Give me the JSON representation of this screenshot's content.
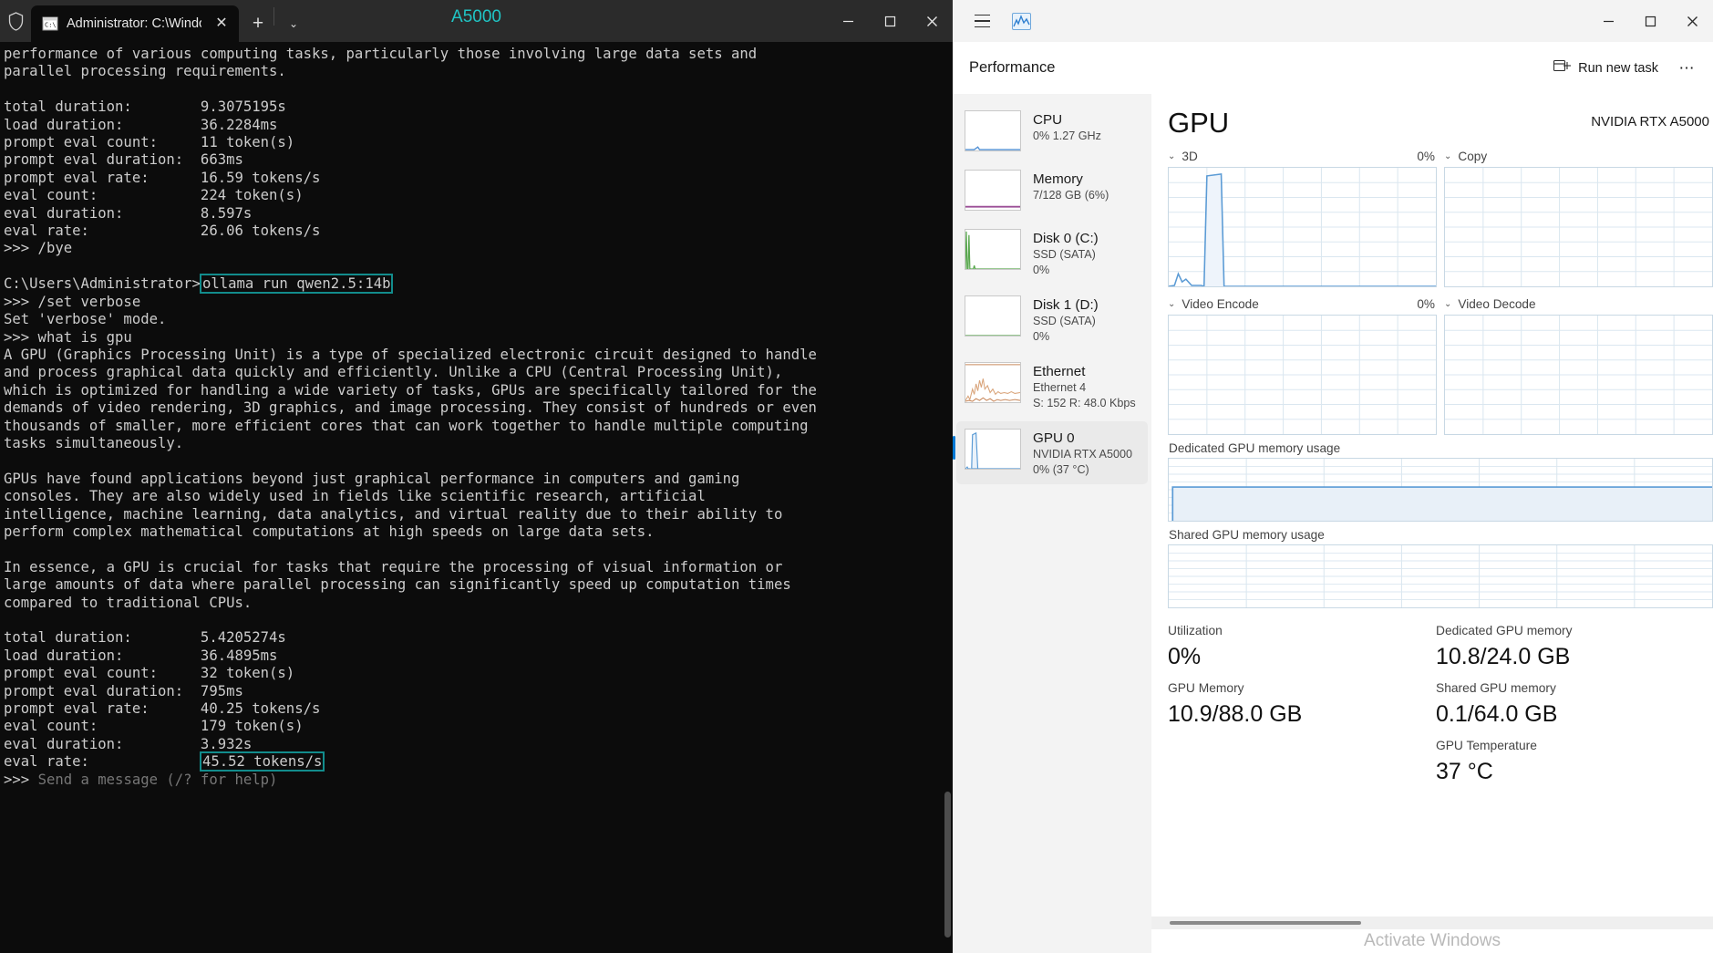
{
  "terminal": {
    "window_title": "A5000",
    "tab_title": "Administrator: C:\\Windows\\s)",
    "tab_close_label": "✕",
    "new_tab_label": "+",
    "dropdown_label": "⌄",
    "minimize_label": "—",
    "maximize_label": "□",
    "close_label": "✕",
    "lines_top": "performance of various computing tasks, particularly those involving large data sets and\nparallel processing requirements.\n\ntotal duration:        9.3075195s\nload duration:         36.2284ms\nprompt eval count:     11 token(s)\nprompt eval duration:  663ms\nprompt eval rate:      16.59 tokens/s\neval count:            224 token(s)\neval duration:         8.597s\neval rate:             26.06 tokens/s\n>>> /bye\n",
    "prompt_path": "C:\\Users\\Administrator>",
    "highlighted_command": "ollama run qwen2.5:14b",
    "lines_mid": "\n>>> /set verbose\nSet 'verbose' mode.\n>>> what is gpu\nA GPU (Graphics Processing Unit) is a type of specialized electronic circuit designed to handle\nand process graphical data quickly and efficiently. Unlike a CPU (Central Processing Unit),\nwhich is optimized for handling a wide variety of tasks, GPUs are specifically tailored for the\ndemands of video rendering, 3D graphics, and image processing. They consist of hundreds or even\nthousands of smaller, more efficient cores that can work together to handle multiple computing\ntasks simultaneously.\n\nGPUs have found applications beyond just graphical performance in computers and gaming\nconsoles. They are also widely used in fields like scientific research, artificial\nintelligence, machine learning, data analytics, and virtual reality due to their ability to\nperform complex mathematical computations at high speeds on large data sets.\n\nIn essence, a GPU is crucial for tasks that require the processing of visual information or\nlarge amounts of data where parallel processing can significantly speed up computation times\ncompared to traditional CPUs.\n\ntotal duration:        5.4205274s\nload duration:         36.4895ms\nprompt eval count:     32 token(s)\nprompt eval duration:  795ms\nprompt eval rate:      40.25 tokens/s\neval count:            179 token(s)\neval duration:         3.932s\neval rate:             ",
    "highlighted_rate": "45.52 tokens/s",
    "prompt_marker": ">>> ",
    "prompt_placeholder": "Send a message (/? for help)",
    "highlight_color": "#128c8c",
    "title_color": "#20c5c5"
  },
  "taskmanager": {
    "titlebar": {
      "menu_label": "hamburger-menu",
      "app_icon": "task-manager-icon",
      "minimize_label": "—",
      "maximize_label": "□",
      "close_label": "✕"
    },
    "header": {
      "title": "Performance",
      "run_new_task": "Run new task",
      "more_options": "⋯"
    },
    "sidebar": [
      {
        "name": "CPU",
        "sub1": "0%  1.27 GHz",
        "sub2": "",
        "color": "#4f8fd4",
        "selected": false
      },
      {
        "name": "Memory",
        "sub1": "7/128 GB (6%)",
        "sub2": "",
        "color": "#9b4f96",
        "selected": false
      },
      {
        "name": "Disk 0 (C:)",
        "sub1": "SSD (SATA)",
        "sub2": "0%",
        "color": "#5aa84f",
        "selected": false
      },
      {
        "name": "Disk 1 (D:)",
        "sub1": "SSD (SATA)",
        "sub2": "0%",
        "color": "#5aa84f",
        "selected": false
      },
      {
        "name": "Ethernet",
        "sub1": "Ethernet 4",
        "sub2": "S: 152 R: 48.0 Kbps",
        "color": "#c98a5e",
        "selected": false
      },
      {
        "name": "GPU 0",
        "sub1": "NVIDIA RTX A5000",
        "sub2": "0% (37 °C)",
        "color": "#5b9bd5",
        "selected": true
      }
    ],
    "gpu": {
      "title": "GPU",
      "model": "NVIDIA RTX A5000",
      "graphs": [
        {
          "label": "3D",
          "value": "0%"
        },
        {
          "label": "Copy",
          "value": ""
        },
        {
          "label": "Video Encode",
          "value": "0%"
        },
        {
          "label": "Video Decode",
          "value": ""
        }
      ],
      "memory_graphs": [
        {
          "label": "Dedicated GPU memory usage"
        },
        {
          "label": "Shared GPU memory usage"
        }
      ],
      "stats": [
        {
          "label": "Utilization",
          "value": "0%"
        },
        {
          "label": "Dedicated GPU memory",
          "value": "10.8/24.0 GB"
        },
        {
          "label": "GPU Memory",
          "value": "10.9/88.0 GB"
        },
        {
          "label": "Shared GPU memory",
          "value": "0.1/64.0 GB"
        },
        {
          "label": "GPU Temperature",
          "value": "37 °C"
        }
      ]
    },
    "watermark": "Activate Windows"
  }
}
